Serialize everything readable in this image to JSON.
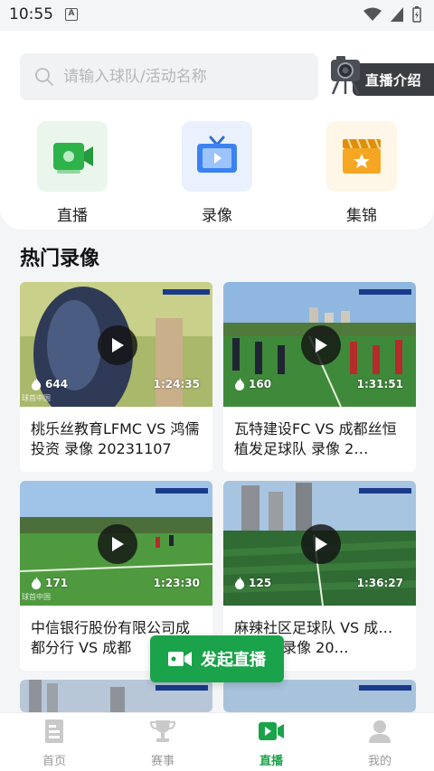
{
  "status": {
    "time": "10:55",
    "a_icon": "A"
  },
  "search": {
    "placeholder": "请输入球队/活动名称"
  },
  "live_intro": {
    "label": "直播介绍"
  },
  "categories": [
    {
      "label": "直播",
      "icon": "video-camera-icon",
      "color": "#2db34a"
    },
    {
      "label": "录像",
      "icon": "tv-icon",
      "color": "#3b82f0"
    },
    {
      "label": "集锦",
      "icon": "clapperboard-icon",
      "color": "#f5a623"
    }
  ],
  "section": {
    "title": "热门录像"
  },
  "videos": [
    {
      "title": "桃乐丝教育LFMC VS 鸿儒投资 录像 20231107",
      "views": "644",
      "duration": "1:24:35"
    },
    {
      "title": "瓦特建设FC VS 成都丝恒植发足球队 录像 2…",
      "views": "160",
      "duration": "1:31:51"
    },
    {
      "title": "中信银行股份有限公司成都分行 VS 成都",
      "views": "171",
      "duration": "1:23:30"
    },
    {
      "title": "麻辣社区足球队 VS 成…足球队 录像 20…",
      "views": "125",
      "duration": "1:36:27"
    }
  ],
  "watermark": "球首中国",
  "fab": {
    "label": "发起直播"
  },
  "tabs": [
    {
      "label": "首页",
      "icon": "home-icon"
    },
    {
      "label": "赛事",
      "icon": "trophy-icon"
    },
    {
      "label": "直播",
      "icon": "live-icon",
      "active": true
    },
    {
      "label": "我的",
      "icon": "profile-icon"
    }
  ],
  "colors": {
    "brand_green": "#1aa34a",
    "background": "#f4f5f7"
  }
}
